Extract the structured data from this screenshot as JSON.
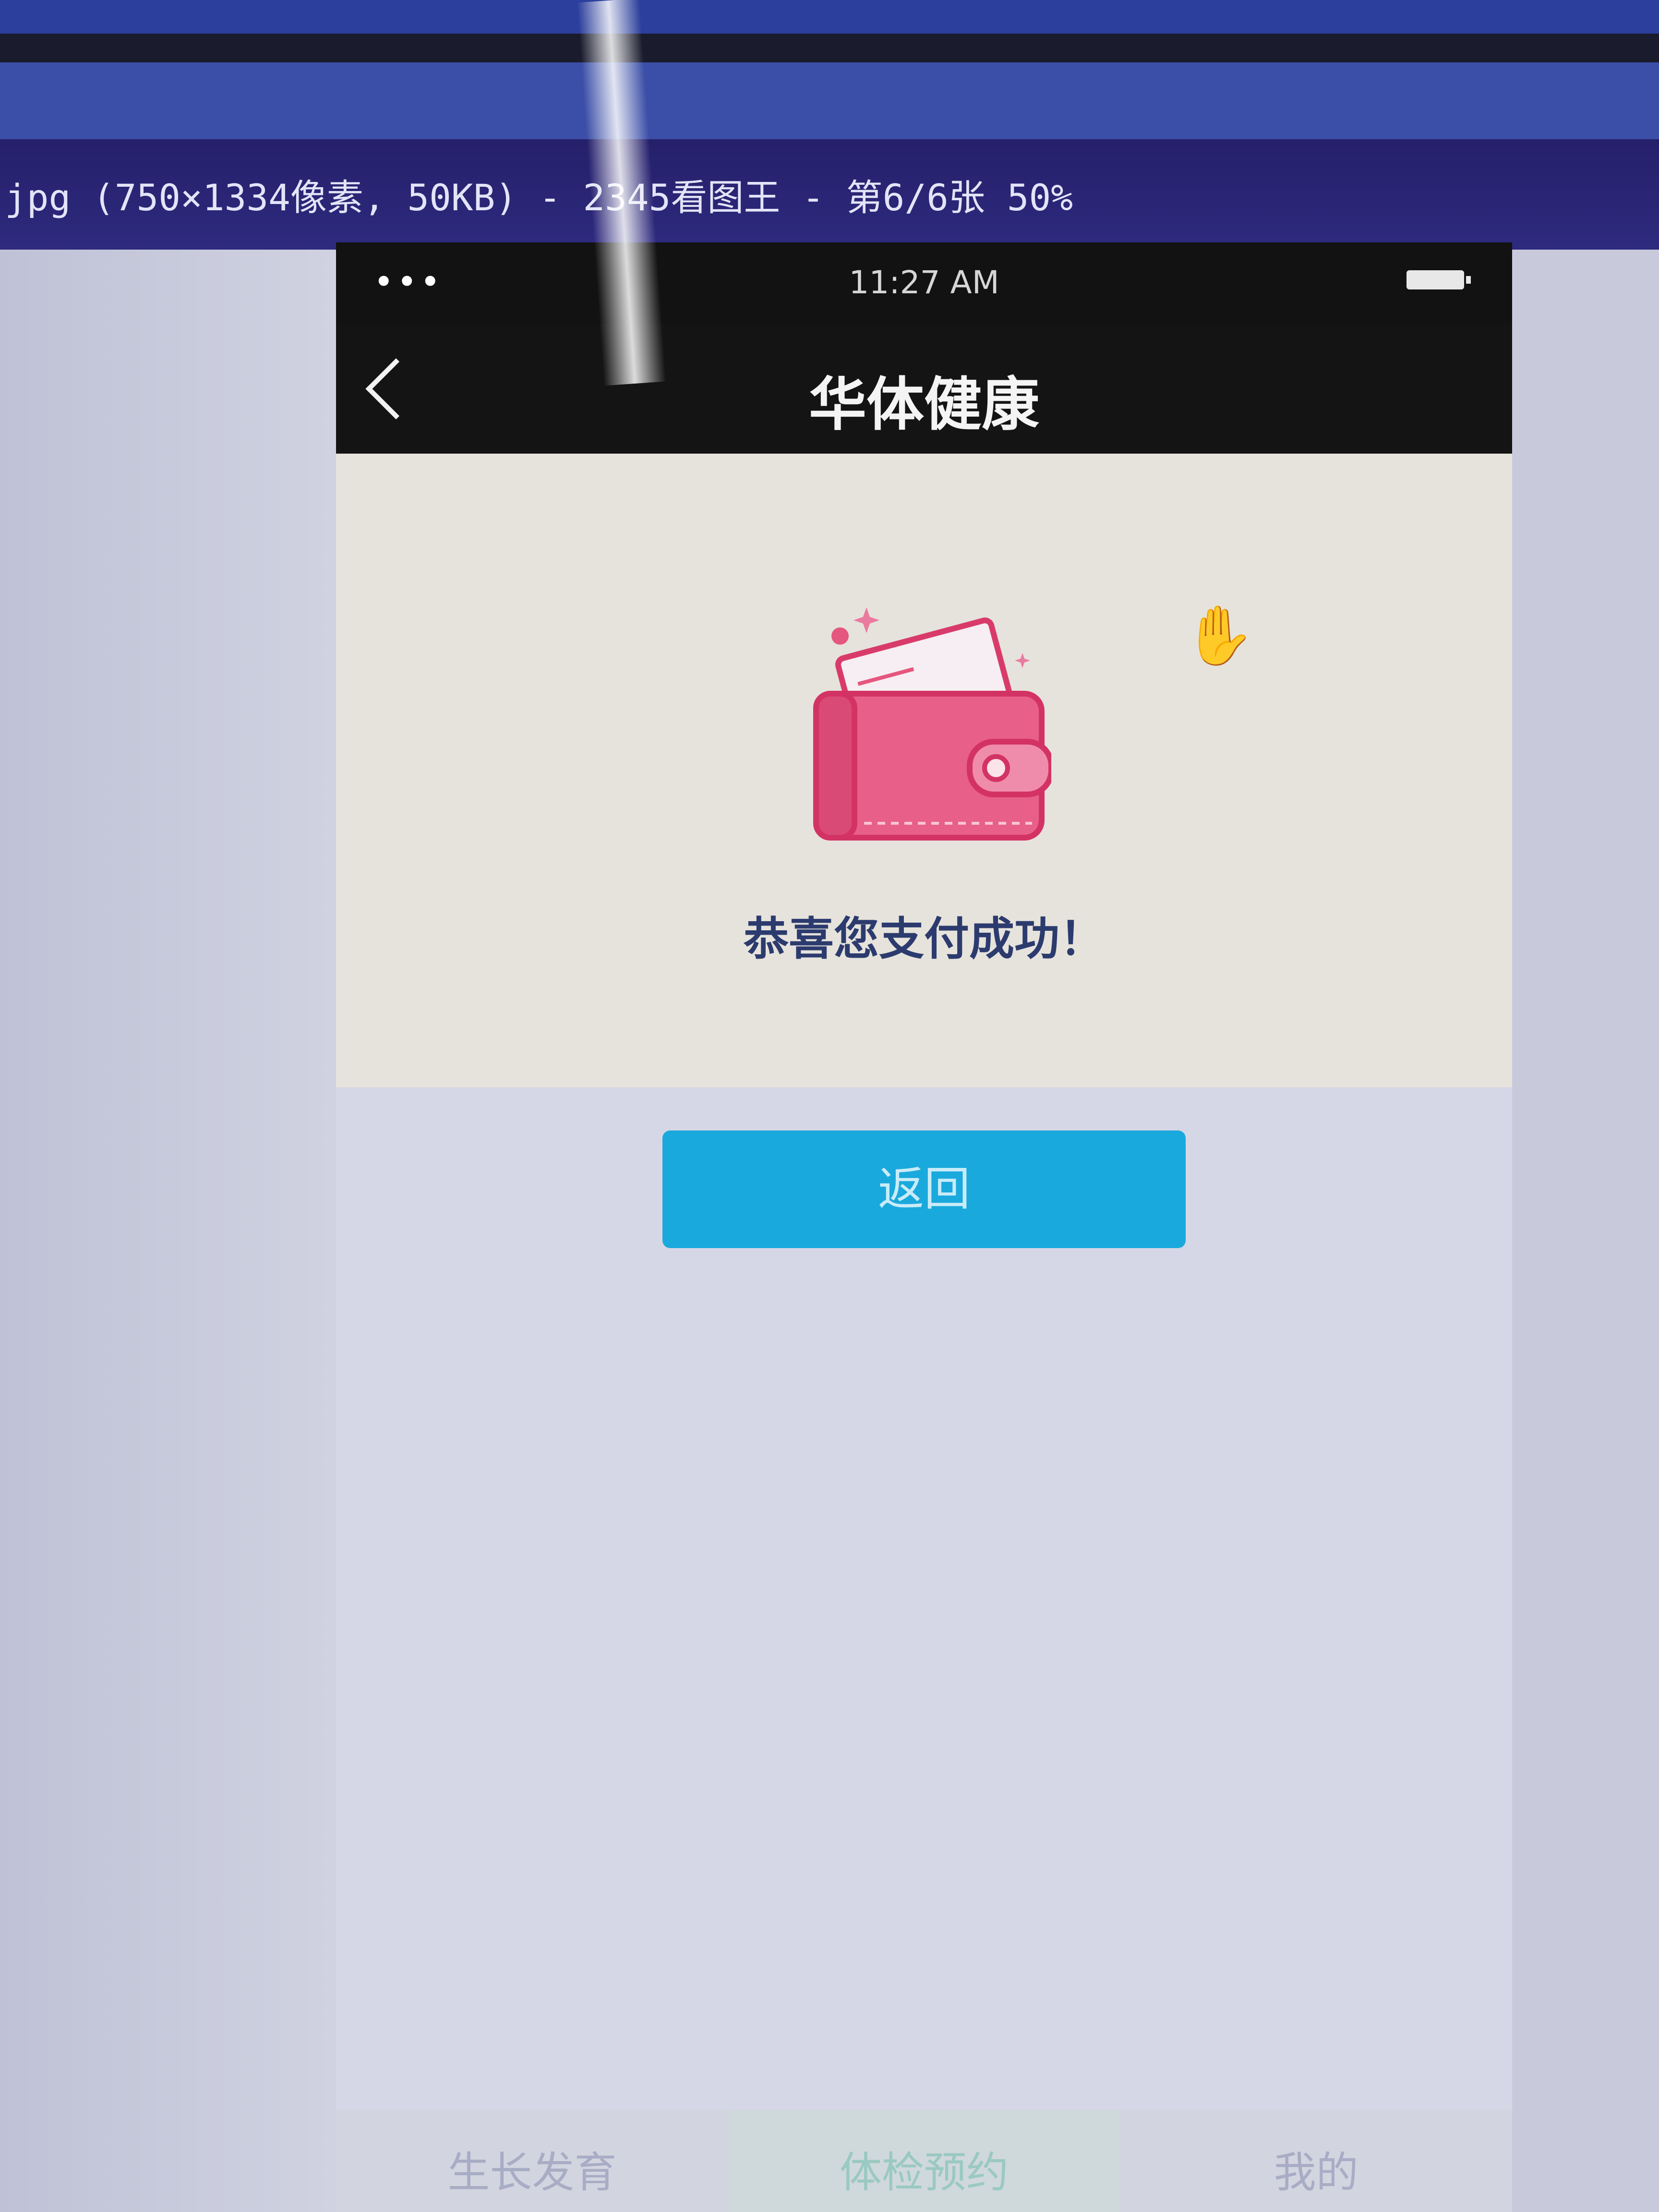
{
  "viewer": {
    "title": "jpg (750×1334像素, 50KB) - 2345看图王 - 第6/6张 50%"
  },
  "status_bar": {
    "signal": "•••",
    "time": "11:27 AM"
  },
  "nav_bar": {
    "title": "华体健康",
    "back_icon": "chevron-left-icon"
  },
  "success": {
    "icon": "wallet-icon",
    "message": "恭喜您支付成功！"
  },
  "return_button": {
    "label": "返回"
  },
  "tab_bar": {
    "items": [
      {
        "label": "生长发育",
        "active": false
      },
      {
        "label": "体检预约",
        "active": true
      },
      {
        "label": "我的",
        "active": false
      }
    ]
  },
  "colors": {
    "primary_button": "#1aa9dc",
    "wallet_pink": "#e5577f",
    "nav_background": "#141414",
    "panel_background": "#e6e3dc"
  }
}
